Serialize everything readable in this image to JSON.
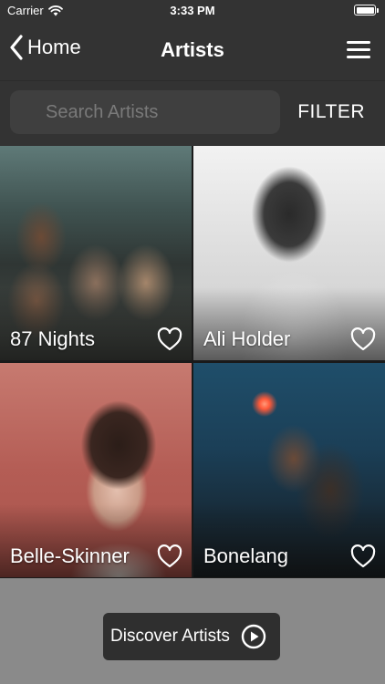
{
  "status_bar": {
    "carrier": "Carrier",
    "time": "3:33 PM"
  },
  "nav": {
    "back_label": "Home",
    "title": "Artists"
  },
  "search": {
    "placeholder": "Search Artists",
    "value": ""
  },
  "filter_label": "FILTER",
  "artists": [
    {
      "name": "87 Nights"
    },
    {
      "name": "Ali Holder"
    },
    {
      "name": "Belle-Skinner"
    },
    {
      "name": "Bonelang"
    }
  ],
  "discover": {
    "label": "Discover Artists"
  },
  "icons": {
    "wifi": "wifi-icon",
    "battery": "battery-icon",
    "back": "chevron-left-icon",
    "menu": "hamburger-menu-icon",
    "favorite": "heart-outline-icon",
    "play": "play-circle-icon"
  },
  "colors": {
    "bar_background": "#333333",
    "search_background": "#3f3f3f",
    "bottom_background": "#8a8a8a",
    "button_background": "#2f2f2f",
    "text": "#ffffff"
  }
}
